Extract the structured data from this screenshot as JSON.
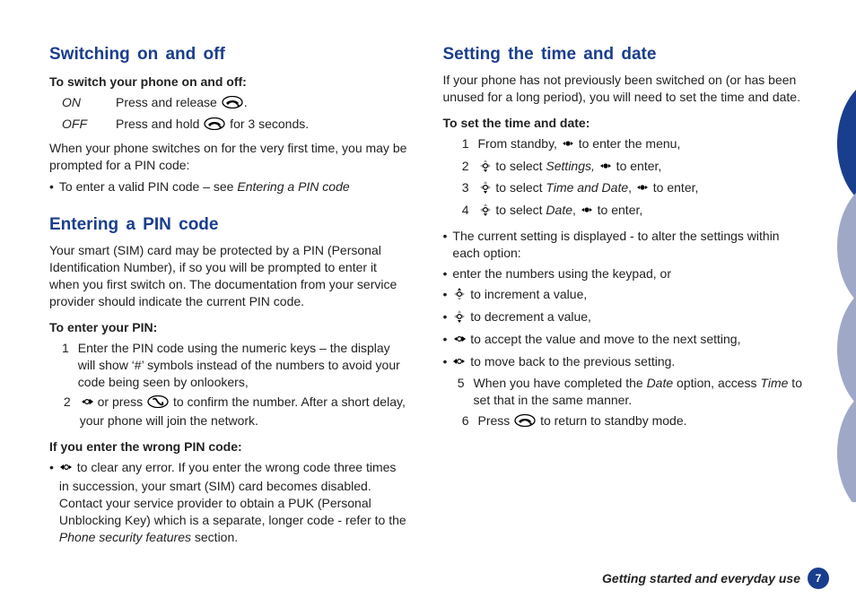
{
  "left": {
    "h_switch": "Switching on and off",
    "b_switch_intro": "To switch your phone on and off:",
    "on_lbl": "ON",
    "on_txt_a": "Press and release ",
    "on_txt_b": ".",
    "off_lbl": "OFF",
    "off_txt_a": "Press and hold ",
    "off_txt_b": " for 3 seconds.",
    "switch_para": "When your phone switches on for the very first time, you may be prompted for a PIN code:",
    "switch_bullet_a": "To enter a valid PIN code – see ",
    "switch_bullet_em": "Entering a PIN code",
    "h_pin": "Entering a PIN code",
    "pin_para": "Your smart (SIM) card may be protected by a PIN (Personal Identification Number), if so you will be prompted to enter it when you first switch on. The documentation from your service provider should indicate the current PIN code.",
    "b_enter": "To enter your PIN:",
    "pin1": "Enter the PIN code using the numeric keys – the display will show ‘#’ symbols instead of the numbers to avoid your code being seen by onlookers,",
    "pin2_a": " or press ",
    "pin2_b": " to confirm the number. After a short delay, your phone will join the network.",
    "b_wrong": "If you enter the wrong PIN code:",
    "wrong_a": " to clear any error. If you enter the wrong code three times in succession, your smart (SIM) card becomes disabled. Contact your service provider to obtain a PUK (Personal Unblocking Key) which is a separate, longer code - refer to the ",
    "wrong_em": "Phone security features",
    "wrong_b": " section."
  },
  "right": {
    "h_time": "Setting the time and date",
    "time_para": "If your phone has not previously been switched on (or has been unused for a long period), you will need to set the time and date.",
    "b_set": "To set the time and date:",
    "s1_a": "From standby, ",
    "s1_b": " to enter the menu,",
    "s2_a": " to select ",
    "s2_em1": "Settings,",
    "s2_b": " ",
    "s2_c": " to enter,",
    "s3_a": " to select ",
    "s3_em": "Time and Date",
    "s3_b": ", ",
    "s3_c": " to enter,",
    "s4_a": " to select ",
    "s4_em": "Date",
    "s4_b": ",  ",
    "s4_c": " to enter,",
    "cur": "The current setting is displayed - to alter the settings within each option:",
    "sb1": "enter the numbers using the keypad, or",
    "sb2": " to increment a value,",
    "sb3": " to decrement a value,",
    "sb4": " to accept the value and move to the next setting,",
    "sb5": " to move back to the previous setting.",
    "s5_a": "When you have completed the ",
    "s5_em1": "Date",
    "s5_b": " option, access ",
    "s5_em2": "Time",
    "s5_c": " to set that in the same manner.",
    "s6_a": "Press ",
    "s6_b": " to return to standby mode."
  },
  "footer": {
    "text": "Getting started and everyday use",
    "page": "7"
  },
  "icons": {
    "end": "end-key-icon",
    "call": "call-key-icon",
    "right": "nav-right-icon",
    "left": "nav-left-icon",
    "up": "nav-up-icon",
    "down": "nav-down-icon",
    "center": "nav-center-icon"
  }
}
